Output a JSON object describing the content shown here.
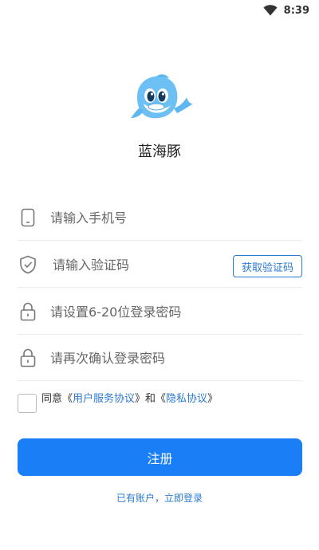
{
  "status_bar": {
    "time": "8:39"
  },
  "app": {
    "name": "蓝海豚"
  },
  "form": {
    "phone_placeholder": "请输入手机号",
    "code_placeholder": "请输入验证码",
    "get_code_label": "获取验证码",
    "password_placeholder": "请设置6-20位登录密码",
    "confirm_placeholder": "请再次确认登录密码"
  },
  "agreement": {
    "prefix": "同意《",
    "terms_link": "用户服务协议",
    "middle": "》和《",
    "privacy_link": "隐私协议",
    "suffix": "》"
  },
  "register_label": "注册",
  "login_link": "已有账户，立即登录",
  "colors": {
    "accent": "#1a7ff7",
    "link": "#2a7ad0"
  },
  "icons": [
    "wifi-icon",
    "dolphin-logo",
    "phone-icon",
    "shield-check-icon",
    "lock-icon"
  ]
}
